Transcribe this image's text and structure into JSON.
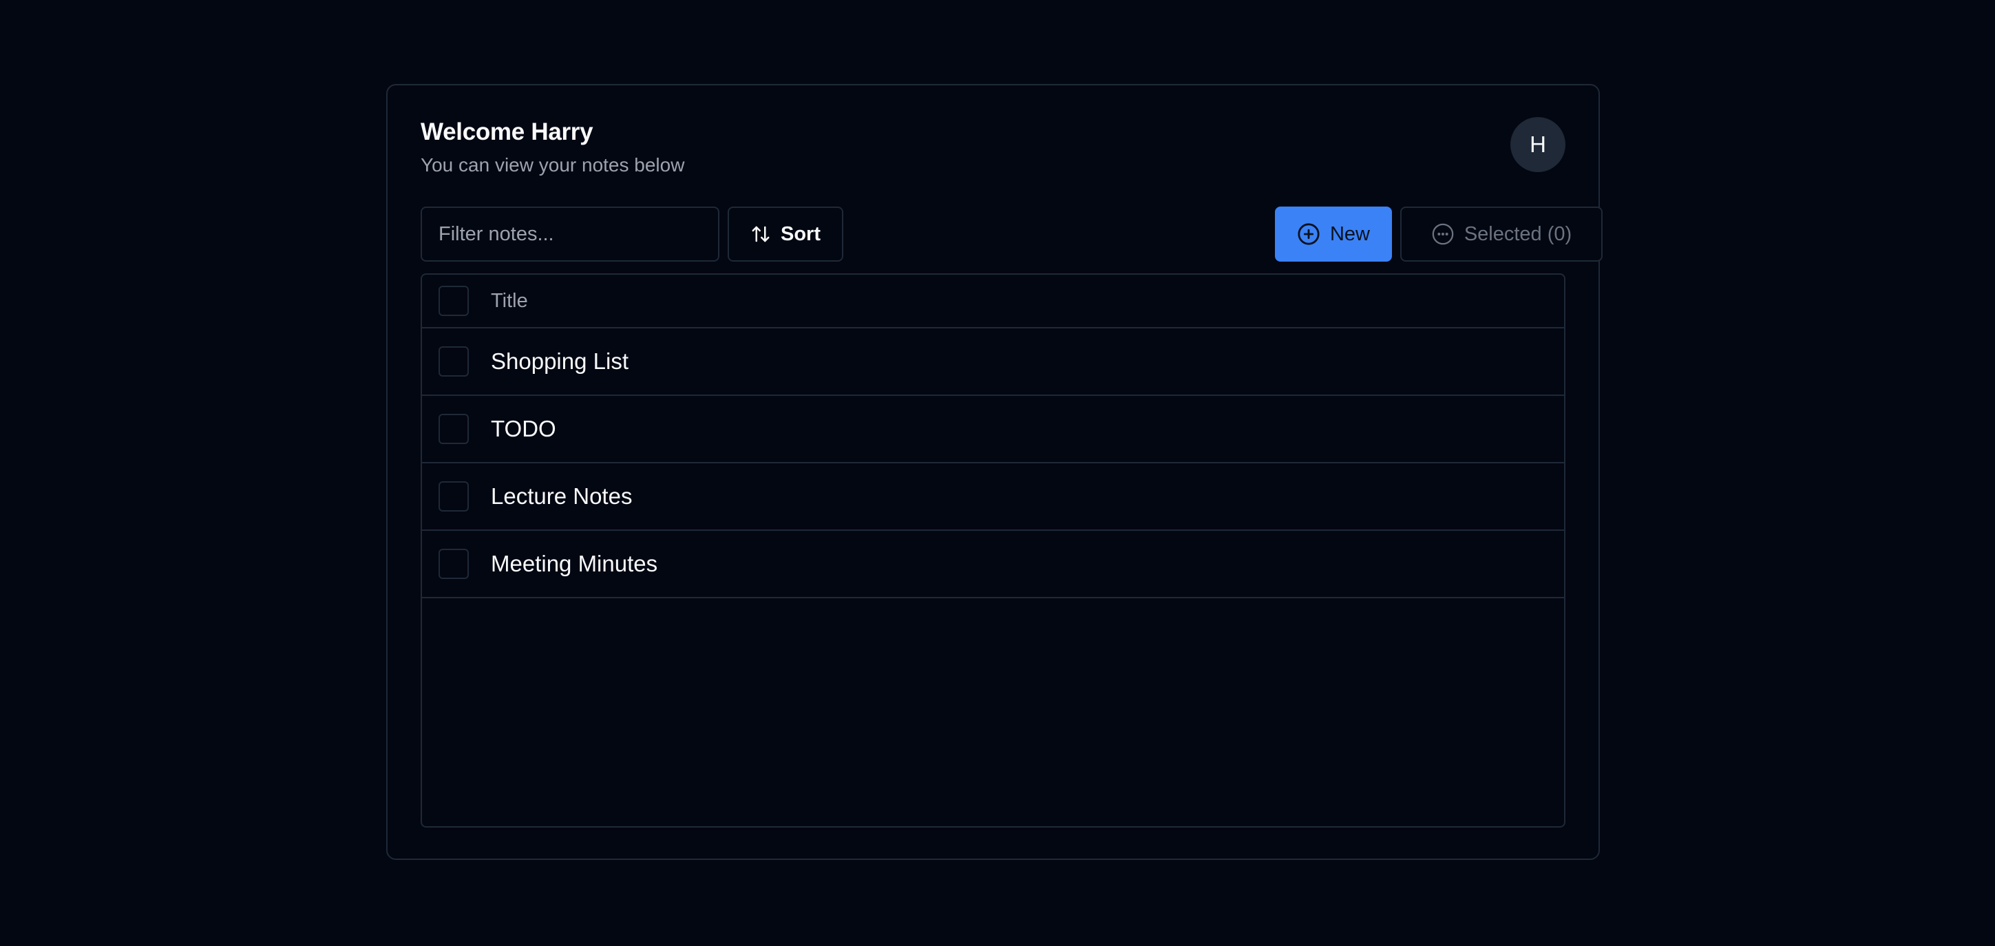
{
  "header": {
    "title": "Welcome Harry",
    "subtitle": "You can view your notes below",
    "avatar_initial": "H"
  },
  "toolbar": {
    "filter_placeholder": "Filter notes...",
    "filter_value": "",
    "sort_label": "Sort",
    "sort_icon": "arrow-up-down-icon",
    "new_label": "New",
    "new_icon": "plus-circle-icon",
    "selected_label": "Selected (0)",
    "selected_icon": "ellipsis-circle-icon"
  },
  "table": {
    "header_title": "Title",
    "rows": [
      {
        "title": "Shopping List",
        "checked": false
      },
      {
        "title": "TODO",
        "checked": false
      },
      {
        "title": "Lecture Notes",
        "checked": false
      },
      {
        "title": "Meeting Minutes",
        "checked": false
      }
    ]
  },
  "colors": {
    "background": "#030712",
    "border": "#1f2937",
    "accent": "#3b82f6",
    "muted_text": "#9ca3af"
  }
}
